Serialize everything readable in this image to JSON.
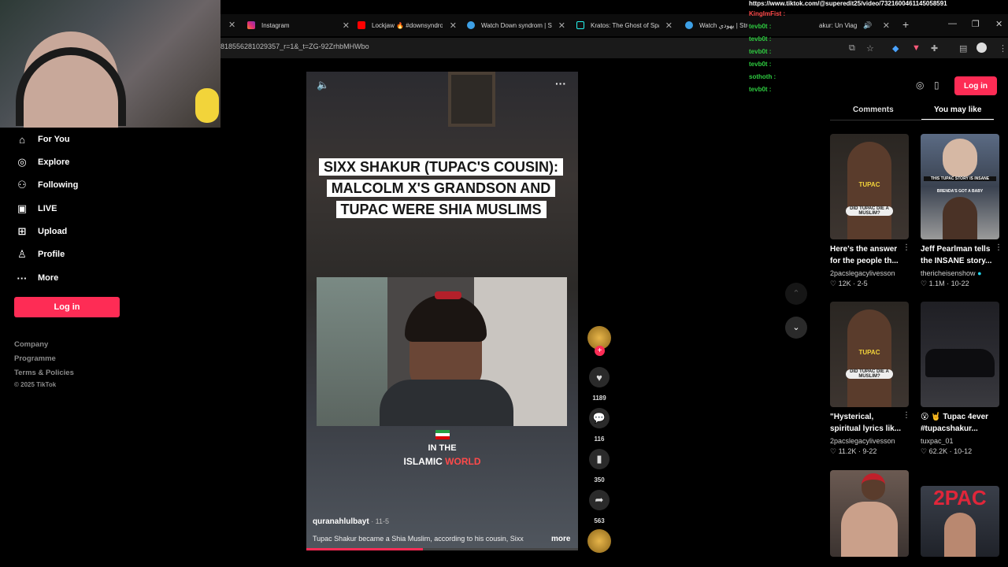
{
  "colors": {
    "accent": "#fe2c55",
    "bg": "#000000",
    "chat_green": "#2ecc40",
    "chat_red": "#ff4a4a"
  },
  "browser": {
    "tabs": [
      {
        "title": "Instagram",
        "icon": "instagram-icon"
      },
      {
        "title": "Lockjaw 🔥 #downsyndro",
        "icon": "youtube-icon"
      },
      {
        "title": "Watch Down syndrom | St",
        "icon": "web-icon"
      },
      {
        "title": "Kratos: The Ghost of Spar",
        "icon": "tiktok-icon"
      },
      {
        "title": "Watch يهودي | Stream",
        "icon": "web-icon"
      },
      {
        "title": "akur: Un Viag",
        "icon": "tiktok-icon"
      }
    ],
    "url_fragment": "818556281029357_r=1&_t=ZG-92ZrhbMHWbo",
    "new_tab": "+"
  },
  "chat": {
    "url": "https://www.tiktok.com/@superedit25/video/7321600461145058591",
    "lines": [
      {
        "user": "KingImFist :",
        "color": "#ff4a4a"
      },
      {
        "user": "tevb0t :",
        "color": "#2ecc40"
      },
      {
        "user": "tevb0t :",
        "color": "#2ecc40"
      },
      {
        "user": "tevb0t :",
        "color": "#2ecc40"
      },
      {
        "user": "tevb0t :",
        "color": "#2ecc40"
      },
      {
        "user": "sothoth :",
        "color": "#2ecc40"
      },
      {
        "user": "tevb0t :",
        "color": "#2ecc40"
      }
    ]
  },
  "nav": {
    "items": [
      {
        "label": "For You",
        "icon": "home-icon"
      },
      {
        "label": "Explore",
        "icon": "compass-icon"
      },
      {
        "label": "Following",
        "icon": "user-follow-icon"
      },
      {
        "label": "LIVE",
        "icon": "live-icon"
      },
      {
        "label": "Upload",
        "icon": "upload-icon"
      },
      {
        "label": "Profile",
        "icon": "profile-icon"
      },
      {
        "label": "More",
        "icon": "more-dots-icon"
      }
    ],
    "login_label": "Log in",
    "footer": [
      "Company",
      "Programme",
      "Terms & Policies",
      "© 2025 TikTok"
    ]
  },
  "video": {
    "caption_lines": [
      "SIXX SHAKUR (TUPAC'S COUSIN):",
      "MALCOLM X'S GRANDSON AND",
      "TUPAC WERE SHIA MUSLIMS"
    ],
    "overlay_line1": "IN THE",
    "overlay_line2a": "ISLAMIC",
    "overlay_line2b": "WORLD",
    "author": "quranahlulbayt",
    "date": " · 11-5",
    "description": "Tupac Shakur became a Shia Muslim, according to his cousin, Sixx",
    "more_label": "more",
    "progress": 0.43
  },
  "actions": {
    "likes": "1189",
    "comments": "116",
    "saves": "350",
    "shares": "563"
  },
  "header_right": {
    "login_label": "Log in"
  },
  "panel": {
    "tabs": [
      "Comments",
      "You may like"
    ],
    "cards": [
      {
        "title": "Here's the answer",
        "subtitle": "for the people th...",
        "user": "2pacslegacylivesson",
        "stats": "♡ 12K · 2-5",
        "thumb_text": "TUPAC",
        "thumb_sub": "DID TUPAC DIE A MUSLIM?"
      },
      {
        "title": "Jeff Pearlman tells",
        "subtitle": "the INSANE story...",
        "user": "thericheisenshow",
        "stats": "♡ 1.1M · 10-22",
        "thumb_text": "THIS TUPAC STORY IS INSANE",
        "thumb_sub": "BRENDA'S GOT A BABY"
      },
      {
        "title": "\"Hysterical,",
        "subtitle": "spiritual lyrics lik...",
        "user": "2pacslegacylivesson",
        "stats": "♡ 11.2K · 9-22",
        "thumb_text": "TUPAC",
        "thumb_sub": "DID TUPAC DIE A MUSLIM?"
      },
      {
        "title": "😮 🤘 Tupac 4ever",
        "subtitle": "#tupacshakur...",
        "user": "tuxpac_01",
        "stats": "♡ 62.2K · 10-12",
        "thumb_text": "",
        "thumb_sub": ""
      },
      {
        "title": "",
        "subtitle": "",
        "user": "",
        "stats": "",
        "thumb_text": "",
        "thumb_sub": ""
      },
      {
        "title": "",
        "subtitle": "",
        "user": "",
        "stats": "",
        "thumb_text": "2PAC",
        "thumb_sub": ""
      }
    ]
  }
}
